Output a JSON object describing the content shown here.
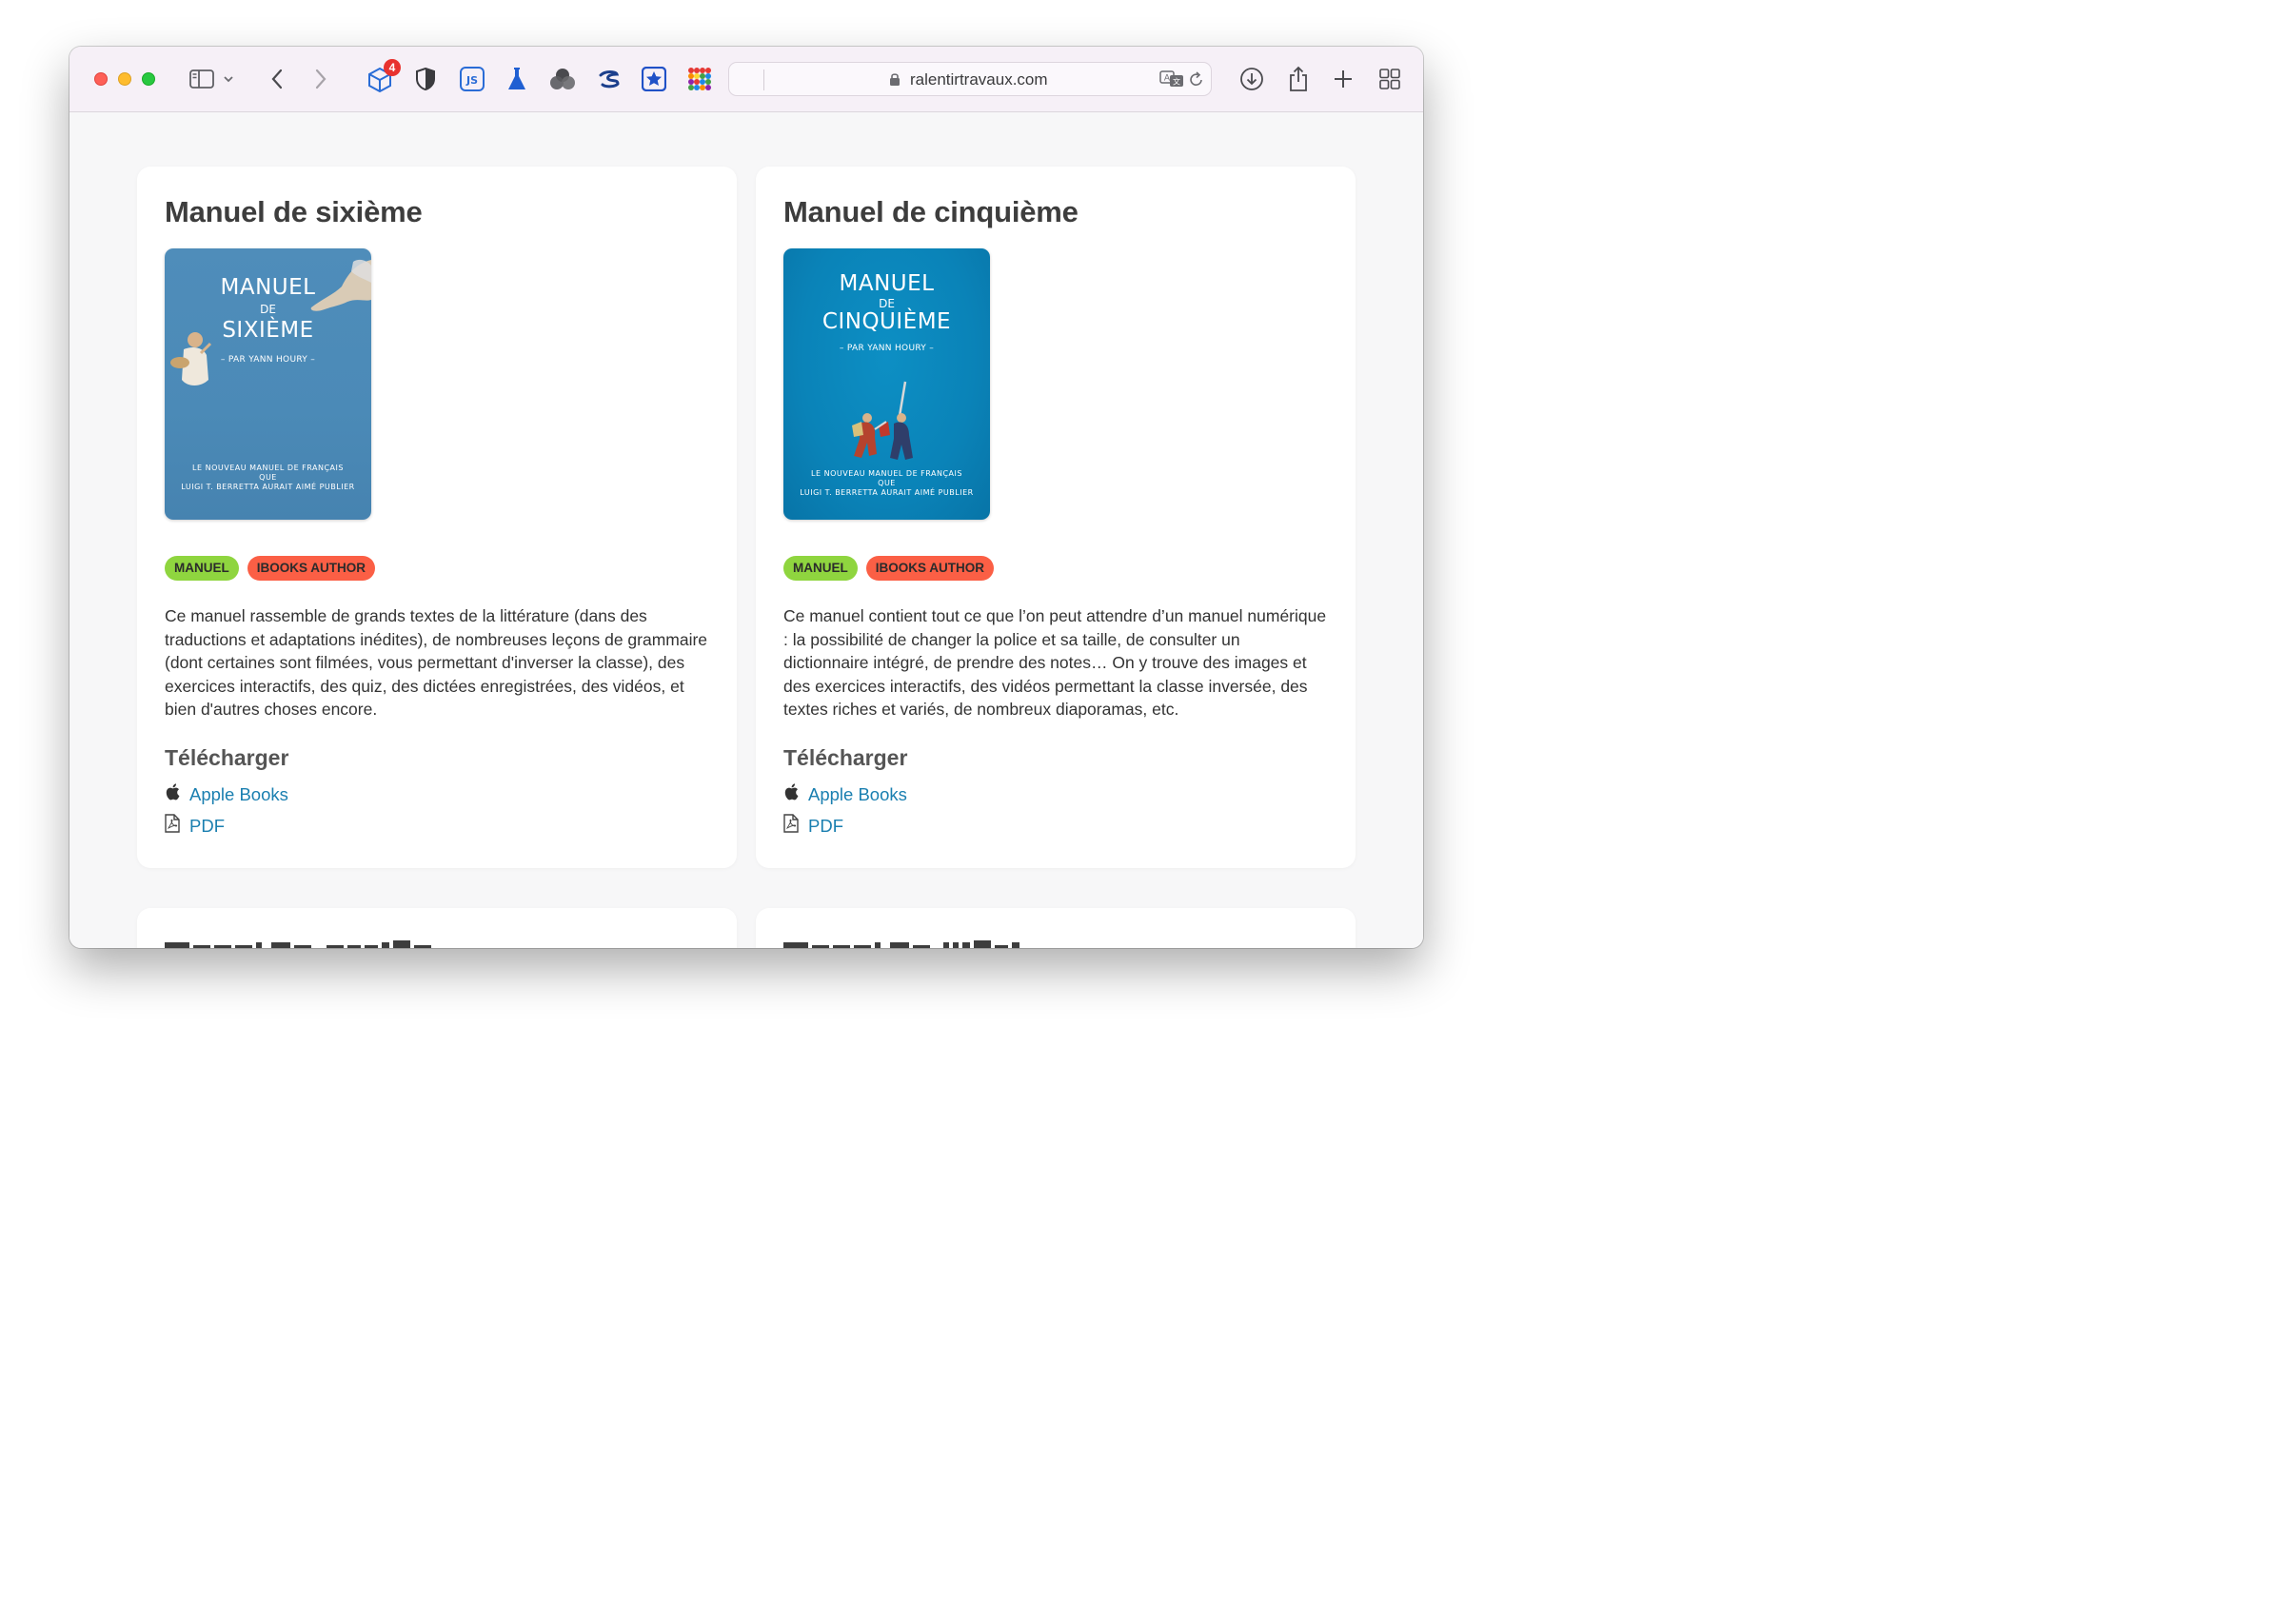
{
  "browser": {
    "extension_badge": "4",
    "url": "ralentirtravaux.com"
  },
  "cards": [
    {
      "title": "Manuel de sixième",
      "cover": {
        "line1": "MANUEL",
        "line2": "DE",
        "line3": "SIXIÈME",
        "author": "– PAR YANN HOURY –",
        "sub1": "LE NOUVEAU MANUEL DE FRANÇAIS",
        "sub2": "QUE",
        "sub3": "LUIGI T. BERRETTA AURAIT AIMÉ PUBLIER"
      },
      "tags": [
        "MANUEL",
        "IBOOKS AUTHOR"
      ],
      "description": "Ce manuel rassemble de grands textes de la littérature (dans des traductions et adaptations inédites), de nombreuses leçons de grammaire (dont certaines sont filmées, vous permettant d'inverser la classe), des exercices interactifs, des quiz, des dictées enregistrées, des vidéos, et bien d'autres choses encore.",
      "download_title": "Télécharger",
      "links": {
        "apple_books": "Apple Books",
        "pdf": "PDF"
      }
    },
    {
      "title": "Manuel de cinquième",
      "cover": {
        "line1": "MANUEL",
        "line2": "DE",
        "line3": "CINQUIÈME",
        "author": "– PAR YANN HOURY –",
        "sub1": "LE NOUVEAU MANUEL DE FRANÇAIS",
        "sub2": "QUE",
        "sub3": "LUIGI T. BERRETTA AURAIT AIMÉ PUBLIER"
      },
      "tags": [
        "MANUEL",
        "IBOOKS AUTHOR"
      ],
      "description": "Ce manuel contient tout ce que l’on peut attendre d’un manuel numérique : la possibilité de changer la police et sa taille, de consulter un dictionnaire intégré, de prendre des notes… On y trouve des images et des exercices interactifs, des vidéos permettant la classe inversée, des textes riches et variés, de nombreux diaporamas, etc.",
      "download_title": "Télécharger",
      "links": {
        "apple_books": "Apple Books",
        "pdf": "PDF"
      }
    }
  ],
  "colors": {
    "tag_manuel": "#8fd53f",
    "tag_ibooks": "#fb5f45",
    "link": "#1a7fb0"
  }
}
